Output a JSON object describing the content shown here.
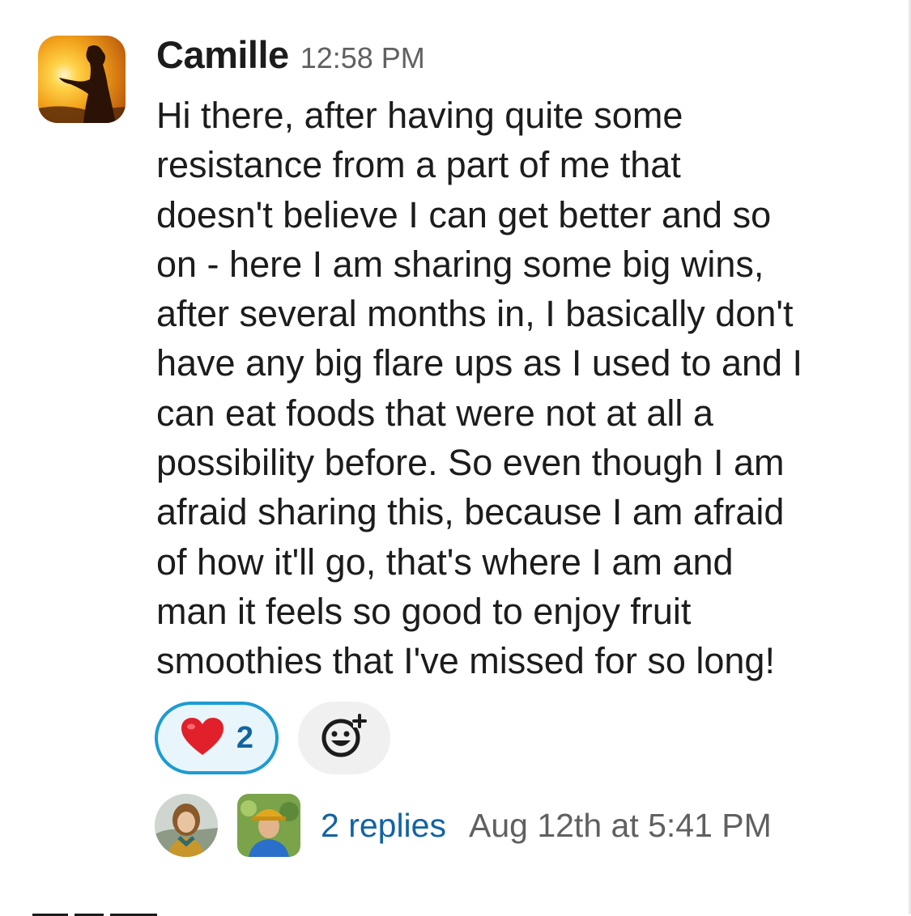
{
  "message": {
    "author": "Camille",
    "time": "12:58 PM",
    "avatar_icon": "profile-photo-sunset-silhouette",
    "body_lines": [
      "Hi there, after having quite some",
      "resistance from a part of me that",
      "doesn't believe I can get better and so",
      "on - here I am sharing some big wins,",
      "after several months in, I basically don't",
      "have any big flare ups as I used to and I",
      "can eat foods that were not at all a",
      "possibility before. So even though I am",
      "afraid sharing this, because I am afraid",
      "of how it'll go, that's where I am and",
      "man it feels so good to enjoy fruit",
      "smoothies that I've missed for so long!"
    ]
  },
  "reactions": [
    {
      "emoji": "❤️",
      "icon": "heart-icon",
      "count": "2"
    }
  ],
  "add_reaction_icon": "add-reaction-icon",
  "thread": {
    "replies_label": "2 replies",
    "last_reply_time": "Aug 12th at 5:41 PM",
    "reply_avatar_icons": [
      "profile-photo-woman-outdoors",
      "profile-photo-woman-hat"
    ]
  },
  "colors": {
    "text": "#1d1c1d",
    "muted": "#616061",
    "link": "#1264a3",
    "reaction_border": "#1d9bd1",
    "reaction_bg": "#e8f5fa"
  }
}
